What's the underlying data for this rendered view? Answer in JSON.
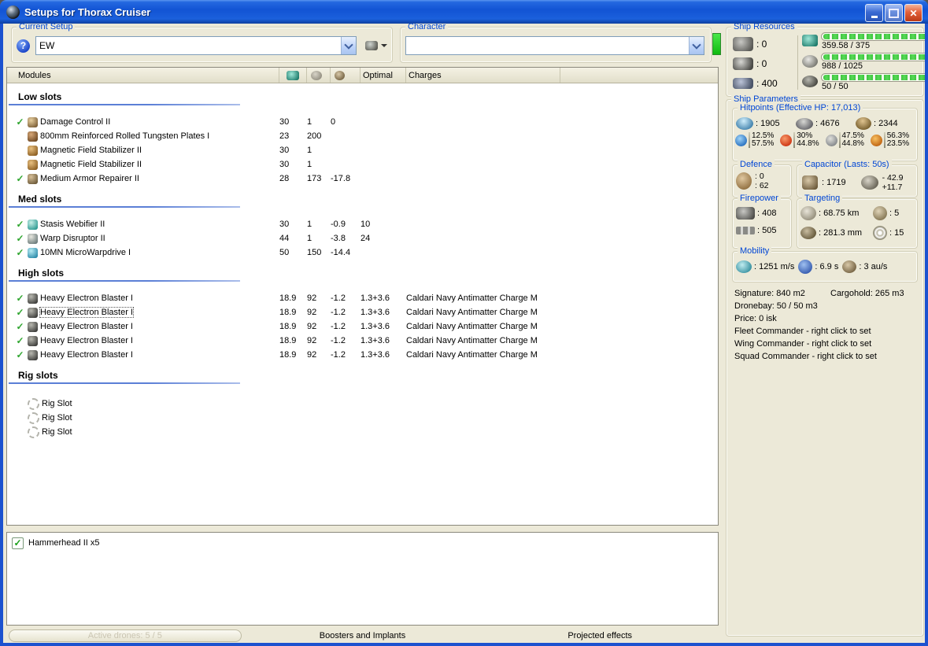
{
  "window": {
    "title": "Setups for Thorax Cruiser"
  },
  "toolbar": {
    "current_setup": {
      "label": "Current Setup",
      "value": "EW"
    },
    "character": {
      "label": "Character",
      "value": ""
    }
  },
  "ship_resources": {
    "label": "Ship Resources",
    "turret_hardpoints": ": 0",
    "launcher_hardpoints": ": 0",
    "calibration": ": 400",
    "cpu_text": "359.58 / 375",
    "powergrid_text": "988 / 1025",
    "dronebay_text": "50 / 50"
  },
  "modules": {
    "header": {
      "name": "Modules",
      "optimal": "Optimal",
      "charges": "Charges"
    },
    "sections": [
      {
        "title": "Low slots",
        "rows": [
          {
            "check": "✓",
            "name": "Damage Control II",
            "c1": "30",
            "c2": "1",
            "c3": "0",
            "c4": "",
            "charge": ""
          },
          {
            "check": "",
            "name": "800mm Reinforced Rolled Tungsten Plates I",
            "c1": "23",
            "c2": "200",
            "c3": "",
            "c4": "",
            "charge": ""
          },
          {
            "check": "",
            "name": "Magnetic Field Stabilizer II",
            "c1": "30",
            "c2": "1",
            "c3": "",
            "c4": "",
            "charge": ""
          },
          {
            "check": "",
            "name": "Magnetic Field Stabilizer II",
            "c1": "30",
            "c2": "1",
            "c3": "",
            "c4": "",
            "charge": ""
          },
          {
            "check": "✓",
            "name": "Medium Armor Repairer II",
            "c1": "28",
            "c2": "173",
            "c3": "-17.8",
            "c4": "",
            "charge": ""
          }
        ]
      },
      {
        "title": "Med slots",
        "rows": [
          {
            "check": "✓",
            "name": "Stasis Webifier II",
            "c1": "30",
            "c2": "1",
            "c3": "-0.9",
            "c4": "10",
            "charge": ""
          },
          {
            "check": "✓",
            "name": "Warp Disruptor II",
            "c1": "44",
            "c2": "1",
            "c3": "-3.8",
            "c4": "24",
            "charge": ""
          },
          {
            "check": "✓",
            "name": "10MN MicroWarpdrive I",
            "c1": "50",
            "c2": "150",
            "c3": "-14.4",
            "c4": "",
            "charge": ""
          }
        ]
      },
      {
        "title": "High slots",
        "rows": [
          {
            "check": "✓",
            "name": "Heavy Electron Blaster I",
            "c1": "18.9",
            "c2": "92",
            "c3": "-1.2",
            "c4": "1.3+3.6",
            "charge": "Caldari Navy Antimatter Charge M"
          },
          {
            "check": "✓",
            "name": "Heavy Electron Blaster I",
            "c1": "18.9",
            "c2": "92",
            "c3": "-1.2",
            "c4": "1.3+3.6",
            "charge": "Caldari Navy Antimatter Charge M"
          },
          {
            "check": "✓",
            "name": "Heavy Electron Blaster I",
            "c1": "18.9",
            "c2": "92",
            "c3": "-1.2",
            "c4": "1.3+3.6",
            "charge": "Caldari Navy Antimatter Charge M"
          },
          {
            "check": "✓",
            "name": "Heavy Electron Blaster I",
            "c1": "18.9",
            "c2": "92",
            "c3": "-1.2",
            "c4": "1.3+3.6",
            "charge": "Caldari Navy Antimatter Charge M"
          },
          {
            "check": "✓",
            "name": "Heavy Electron Blaster I",
            "c1": "18.9",
            "c2": "92",
            "c3": "-1.2",
            "c4": "1.3+3.6",
            "charge": "Caldari Navy Antimatter Charge M"
          }
        ]
      },
      {
        "title": "Rig slots",
        "rows": [
          {
            "name": "Rig Slot"
          },
          {
            "name": "Rig Slot"
          },
          {
            "name": "Rig Slot"
          }
        ]
      }
    ]
  },
  "ship_parameters": {
    "label": "Ship Parameters",
    "hitpoints": {
      "label": "Hitpoints (Effective HP: 17,013)",
      "shield": ": 1905",
      "armor": ": 4676",
      "structure": ": 2344",
      "resists": {
        "em": [
          "12.5%",
          "57.5%"
        ],
        "thermal": [
          "30%",
          "44.8%"
        ],
        "kinetic": [
          "47.5%",
          "44.8%"
        ],
        "explosive": [
          "56.3%",
          "23.5%"
        ]
      }
    },
    "defence": {
      "label": "Defence",
      "v1": ": 0",
      "v2": ": 62"
    },
    "capacitor": {
      "label": "Capacitor (Lasts: 50s)",
      "amount": ": 1719",
      "drain": "- 42.9",
      "recharge": "+11.7"
    },
    "firepower": {
      "label": "Firepower",
      "dps": ": 408",
      "volley": ": 505"
    },
    "targeting": {
      "label": "Targeting",
      "range": ": 68.75 km",
      "max_targets": ": 5",
      "scan_res": ": 281.3 mm",
      "sensor": ": 15"
    },
    "mobility": {
      "label": "Mobility",
      "speed": ": 1251 m/s",
      "align": ": 6.9 s",
      "warp": ": 3 au/s"
    },
    "info": [
      "Signature: 840 m2",
      "Cargohold: 265 m3",
      "Dronebay: 50 / 50 m3",
      "Price: 0 isk",
      "Fleet Commander - right click to set",
      "Wing Commander - right click to set",
      "Squad Commander - right click to set"
    ]
  },
  "drones": {
    "items": [
      {
        "label": "Hammerhead II x5",
        "checked": true
      }
    ]
  },
  "bottom_bar": {
    "active_drones": "Active drones: 5 / 5",
    "boosters": "Boosters and Implants",
    "projected": "Projected effects"
  },
  "colors": {
    "titlebar_blue": "#1254d4",
    "client_bg": "#ECE9D8",
    "groupbox_caption": "#0046d5",
    "progress_green": "#3ec43e",
    "check_green": "#2fa52f",
    "close_red": "#bc3a16"
  }
}
